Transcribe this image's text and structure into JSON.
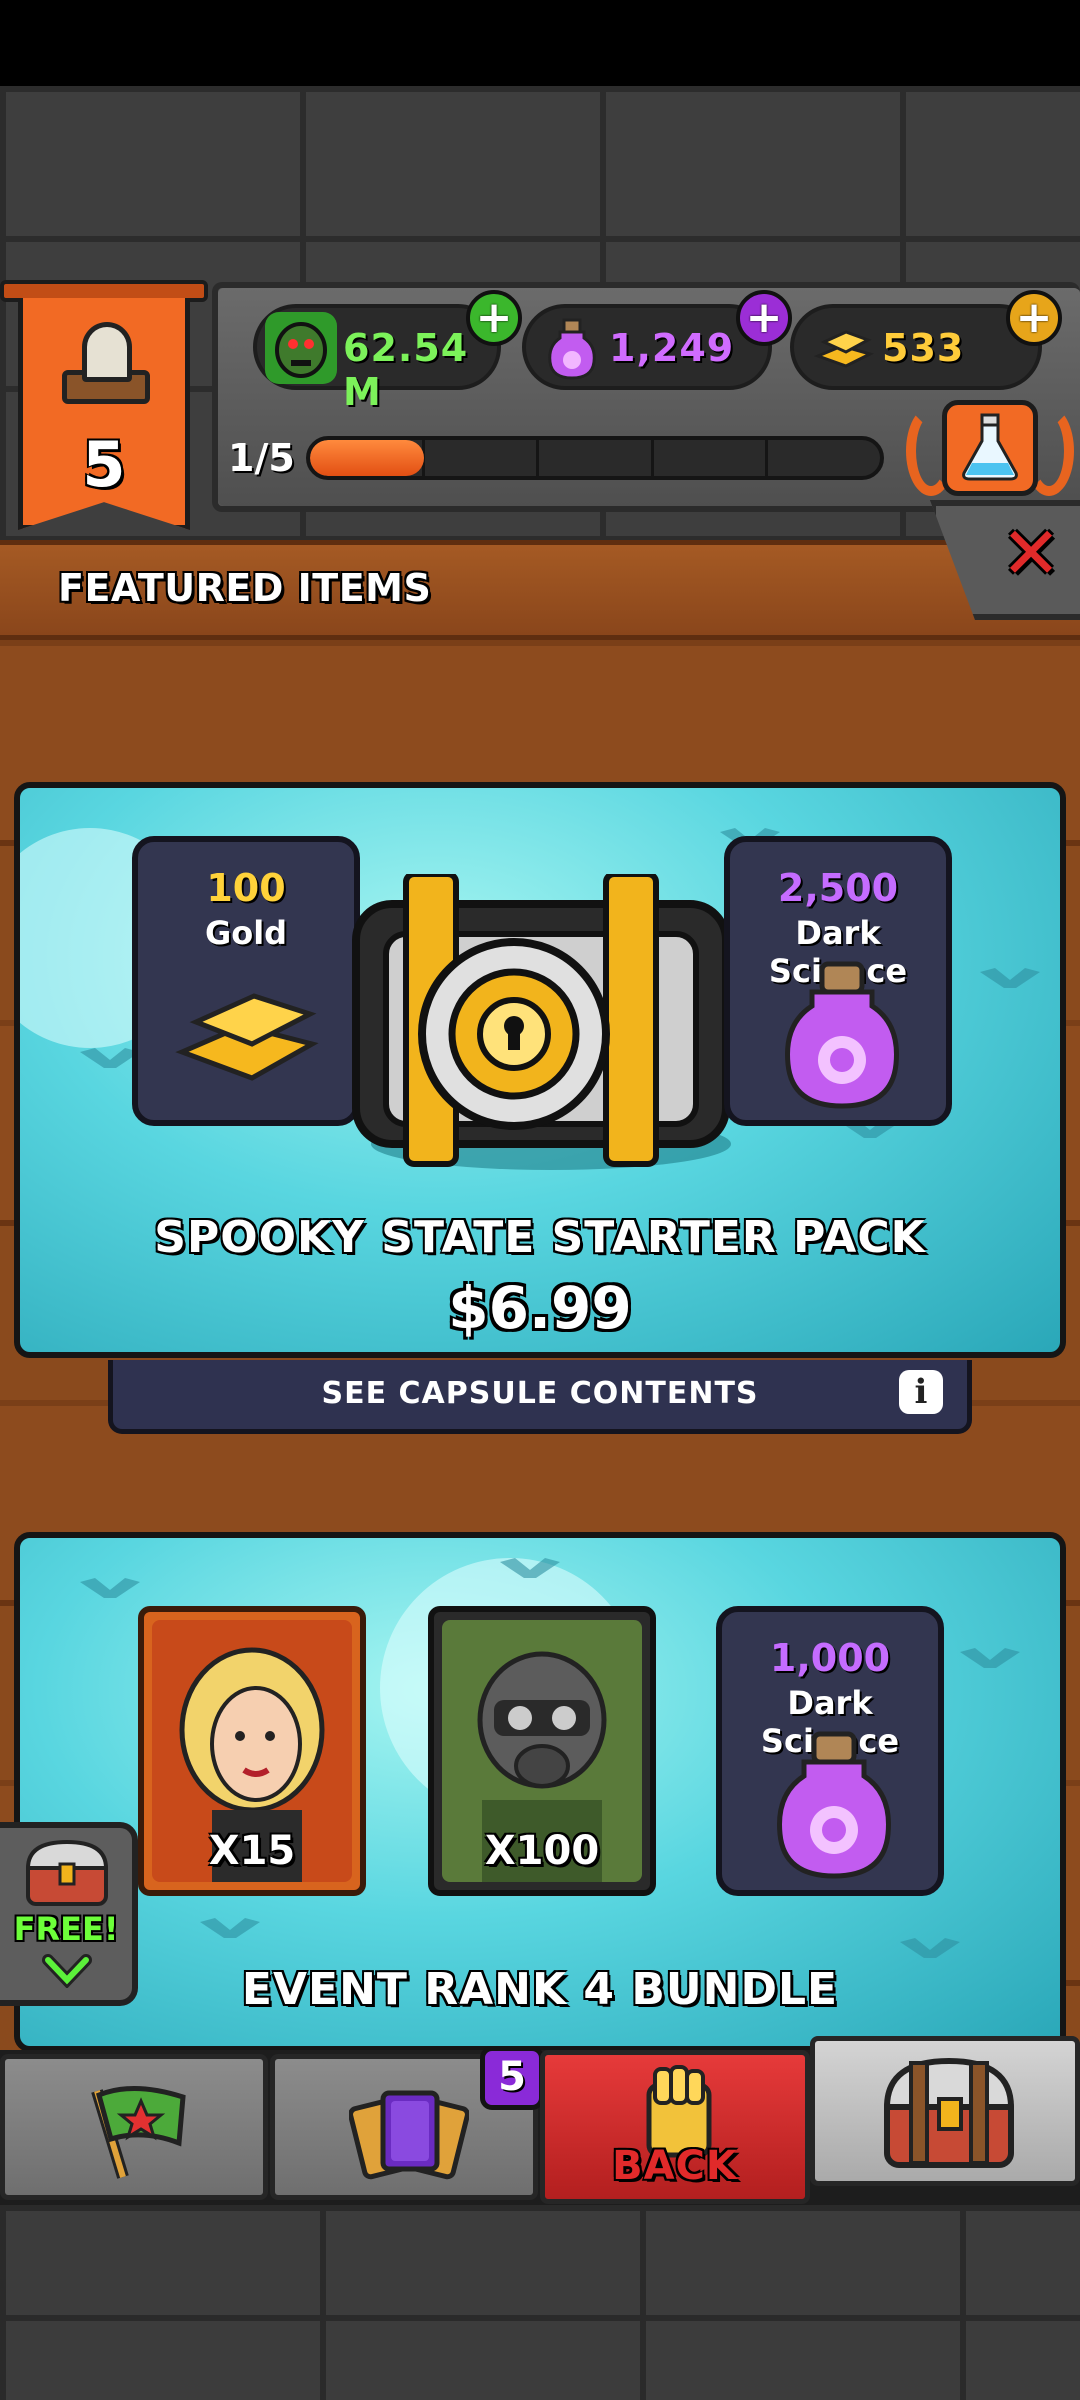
{
  "hud": {
    "level": "5",
    "progress_label": "1/5",
    "progress_fraction": 0.2,
    "currencies": [
      {
        "name": "zombies",
        "value": "62.54 M",
        "icon": "zombie-head-icon"
      },
      {
        "name": "dark_science",
        "value": "1,249",
        "icon": "dark-science-potion-icon"
      },
      {
        "name": "gold",
        "value": "533",
        "icon": "gold-bars-icon"
      }
    ],
    "plus_symbol": "+"
  },
  "header": {
    "title": "FEATURED ITEMS",
    "close_symbol": "✕"
  },
  "offers": [
    {
      "title": "SPOOKY STATE STARTER PACK",
      "price": "$6.99",
      "see_contents_label": "SEE CAPSULE CONTENTS",
      "info_symbol": "i",
      "items": [
        {
          "amount": "100",
          "name": "Gold",
          "icon": "gold-bars-icon"
        },
        {
          "amount": "2,500",
          "name": "Dark Science",
          "icon": "dark-science-potion-icon"
        }
      ],
      "center_icon": "vault-safe-icon"
    },
    {
      "title": "EVENT RANK 4 BUNDLE",
      "items": [
        {
          "qty": "X15",
          "icon": "blonde-woman-portrait-icon"
        },
        {
          "qty": "X100",
          "icon": "gasmask-soldier-portrait-icon"
        },
        {
          "amount": "1,000",
          "name": "Dark Science",
          "icon": "dark-science-potion-icon"
        }
      ]
    }
  ],
  "free_tab": {
    "label": "FREE!",
    "icon": "chest-icon"
  },
  "nav": {
    "back_label": "BACK",
    "cards_badge": "5",
    "items": [
      "flag-icon",
      "cards-icon",
      "back-hand-icon",
      "chest-icon"
    ]
  },
  "colors": {
    "zombie_green": "#7cf25a",
    "dark_science_purple": "#d06cff",
    "gold_yellow": "#ffcc3a",
    "banner_orange": "#f26a24",
    "back_red": "#e12a2a"
  }
}
